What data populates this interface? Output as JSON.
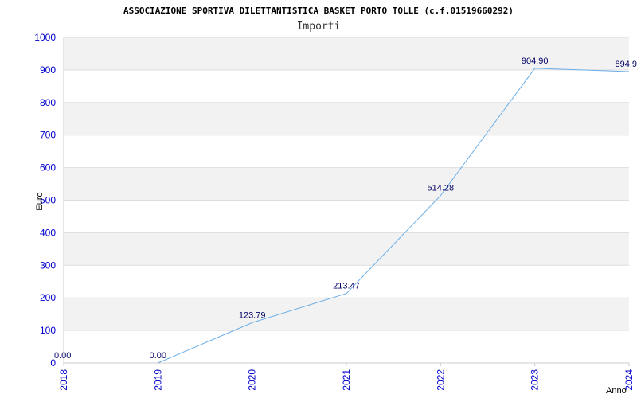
{
  "chart_data": {
    "type": "line",
    "title": "ASSOCIAZIONE SPORTIVA DILETTANTISTICA BASKET PORTO TOLLE (c.f.01519660292)",
    "subtitle": "Importi",
    "ylabel": "Euro",
    "xlabel": "Anno",
    "categories": [
      "2018",
      "2019",
      "2020",
      "2021",
      "2022",
      "2023",
      "2024"
    ],
    "values": [
      0,
      0,
      123.79,
      213.47,
      514.28,
      904.9,
      894.9
    ],
    "data_labels": [
      "0.00",
      "0.00",
      "123.79",
      "213.47",
      "514.28",
      "904.90",
      "894.9"
    ],
    "ylim": [
      0,
      1000
    ],
    "yticks": [
      "0",
      "100",
      "200",
      "300",
      "400",
      "500",
      "600",
      "700",
      "800",
      "900",
      "1000"
    ],
    "grid": true,
    "colors": {
      "line": "#6aaee8",
      "band": "#f2f2f2",
      "grid": "#dddddd",
      "tick": "#0000cc",
      "data_label": "#000066"
    }
  }
}
